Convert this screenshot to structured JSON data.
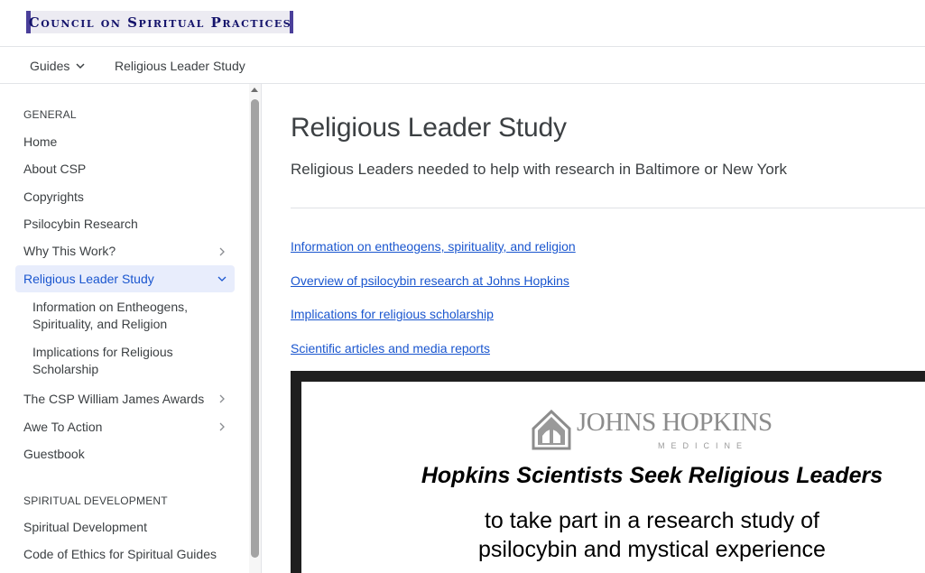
{
  "header": {
    "logo_text": "Council on Spiritual Practices"
  },
  "subnav": {
    "guides_label": "Guides",
    "current_label": "Religious Leader Study"
  },
  "sidebar": {
    "general_heading": "GENERAL",
    "items": [
      {
        "label": "Home"
      },
      {
        "label": "About CSP"
      },
      {
        "label": "Copyrights"
      },
      {
        "label": "Psilocybin Research"
      },
      {
        "label": "Why This Work?"
      },
      {
        "label": "Religious Leader Study"
      },
      {
        "label": "Information on Entheogens, Spirituality, and Religion"
      },
      {
        "label": "Implications for Religious Scholarship"
      },
      {
        "label": "The CSP William James Awards"
      },
      {
        "label": "Awe To Action"
      },
      {
        "label": "Guestbook"
      }
    ],
    "spiritual_heading": "SPIRITUAL DEVELOPMENT",
    "spiritual_items": [
      {
        "label": "Spiritual Development"
      },
      {
        "label": "Code of Ethics for Spiritual Guides"
      }
    ]
  },
  "main": {
    "title": "Religious Leader Study",
    "subtitle": "Religious Leaders needed to help with research in Baltimore or New York",
    "links": [
      {
        "label": "Information on entheogens, spirituality, and religion"
      },
      {
        "label": "Overview of psilocybin research at Johns Hopkins"
      },
      {
        "label": "Implications for religious scholarship"
      },
      {
        "label": "Scientific articles and media reports"
      }
    ],
    "flyer": {
      "org_name": "JOHNS HOPKINS",
      "org_sub": "MEDICINE",
      "headline": "Hopkins Scientists Seek Religious Leaders",
      "body_line1": "to take part in a research study of",
      "body_line2": "psilocybin and mystical experience"
    }
  },
  "colors": {
    "accent": "#1a56cf",
    "active_bg": "#e8edfc",
    "logo_border": "#4a3f9a",
    "logo_text": "#14136b"
  }
}
